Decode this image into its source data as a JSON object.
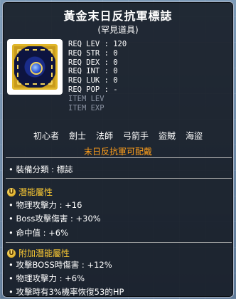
{
  "item": {
    "name": "黃金末日反抗軍標誌",
    "rarity": "(罕見道具)",
    "requirements": [
      {
        "label": "REQ LEV",
        "value": ": 120"
      },
      {
        "label": "REQ STR",
        "value": ": 0"
      },
      {
        "label": "REQ DEX",
        "value": ": 0"
      },
      {
        "label": "REQ INT",
        "value": ": 0"
      },
      {
        "label": "REQ LUK",
        "value": ": 0"
      },
      {
        "label": "REQ POP",
        "value": ": -"
      },
      {
        "label": "ITEM LEV",
        "value": ""
      },
      {
        "label": "ITEM EXP",
        "value": ""
      }
    ],
    "jobs": [
      "初心者",
      "劍士",
      "法師",
      "弓箭手",
      "盜賊",
      "海盜"
    ],
    "job_warning": "末日反抗軍可配戴",
    "category": "• 裝備分類 : 標誌"
  },
  "potential": {
    "header": "潛能屬性",
    "badge": "U",
    "lines": [
      "• 物理攻擊力 : +16",
      "• Boss攻擊傷害 : +30%",
      "• 命中值 : +6%"
    ]
  },
  "bonus_potential": {
    "header": "附加潛能屬性",
    "badge": "U",
    "lines": [
      "• 攻擊BOSS時傷害 : +12%",
      "• 物理攻擊力 : +6%",
      "• 攻擊時有3%機率恢復53的HP"
    ]
  },
  "colors": {
    "title": "#ffffff",
    "warning": "#ff9e1a",
    "section_header": "#ffcc33",
    "dim_text": "#8b93a3"
  },
  "icons": {
    "item_icon": "gold-resistance-emblem-icon",
    "potential_badge": "unique-grade-icon"
  }
}
